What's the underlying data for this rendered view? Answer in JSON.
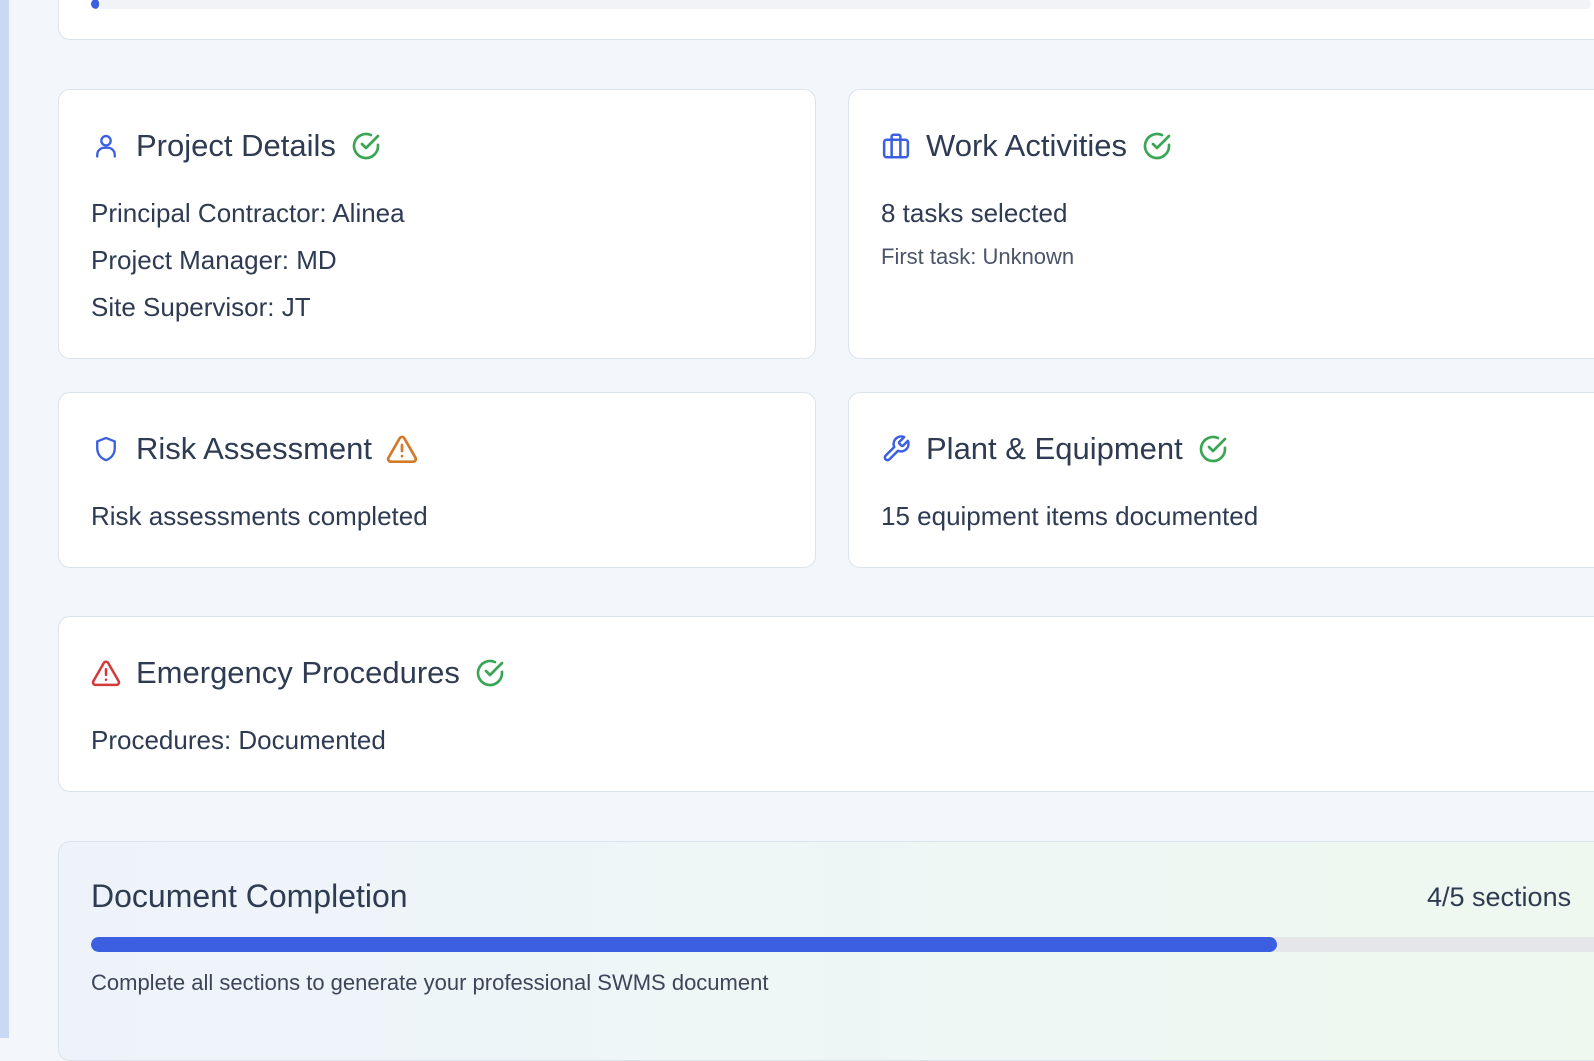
{
  "colors": {
    "accent_blue": "#3b5fe0",
    "success_green": "#3aa655",
    "warning_orange": "#d27a2c",
    "danger_red": "#d23a3a"
  },
  "top_progress": {
    "fraction": 0.003
  },
  "sections": {
    "project_details": {
      "title": "Project Details",
      "icon": "user-icon",
      "status": "complete",
      "lines": [
        "Principal Contractor: Alinea",
        "Project Manager: MD",
        "Site Supervisor: JT"
      ]
    },
    "work_activities": {
      "title": "Work Activities",
      "icon": "briefcase-icon",
      "status": "complete",
      "summary": "8 tasks selected",
      "detail": "First task: Unknown"
    },
    "risk_assessment": {
      "title": "Risk Assessment",
      "icon": "shield-icon",
      "status": "warning",
      "summary": "Risk assessments completed"
    },
    "plant_equipment": {
      "title": "Plant & Equipment",
      "icon": "wrench-icon",
      "status": "complete",
      "summary": "15 equipment items documented"
    },
    "emergency_procedures": {
      "title": "Emergency Procedures",
      "icon": "alert-triangle-icon",
      "status": "complete",
      "summary": "Procedures: Documented"
    }
  },
  "completion": {
    "title": "Document Completion",
    "count_label": "4/5 sections",
    "fraction": 0.8,
    "note": "Complete all sections to generate your professional SWMS document"
  }
}
